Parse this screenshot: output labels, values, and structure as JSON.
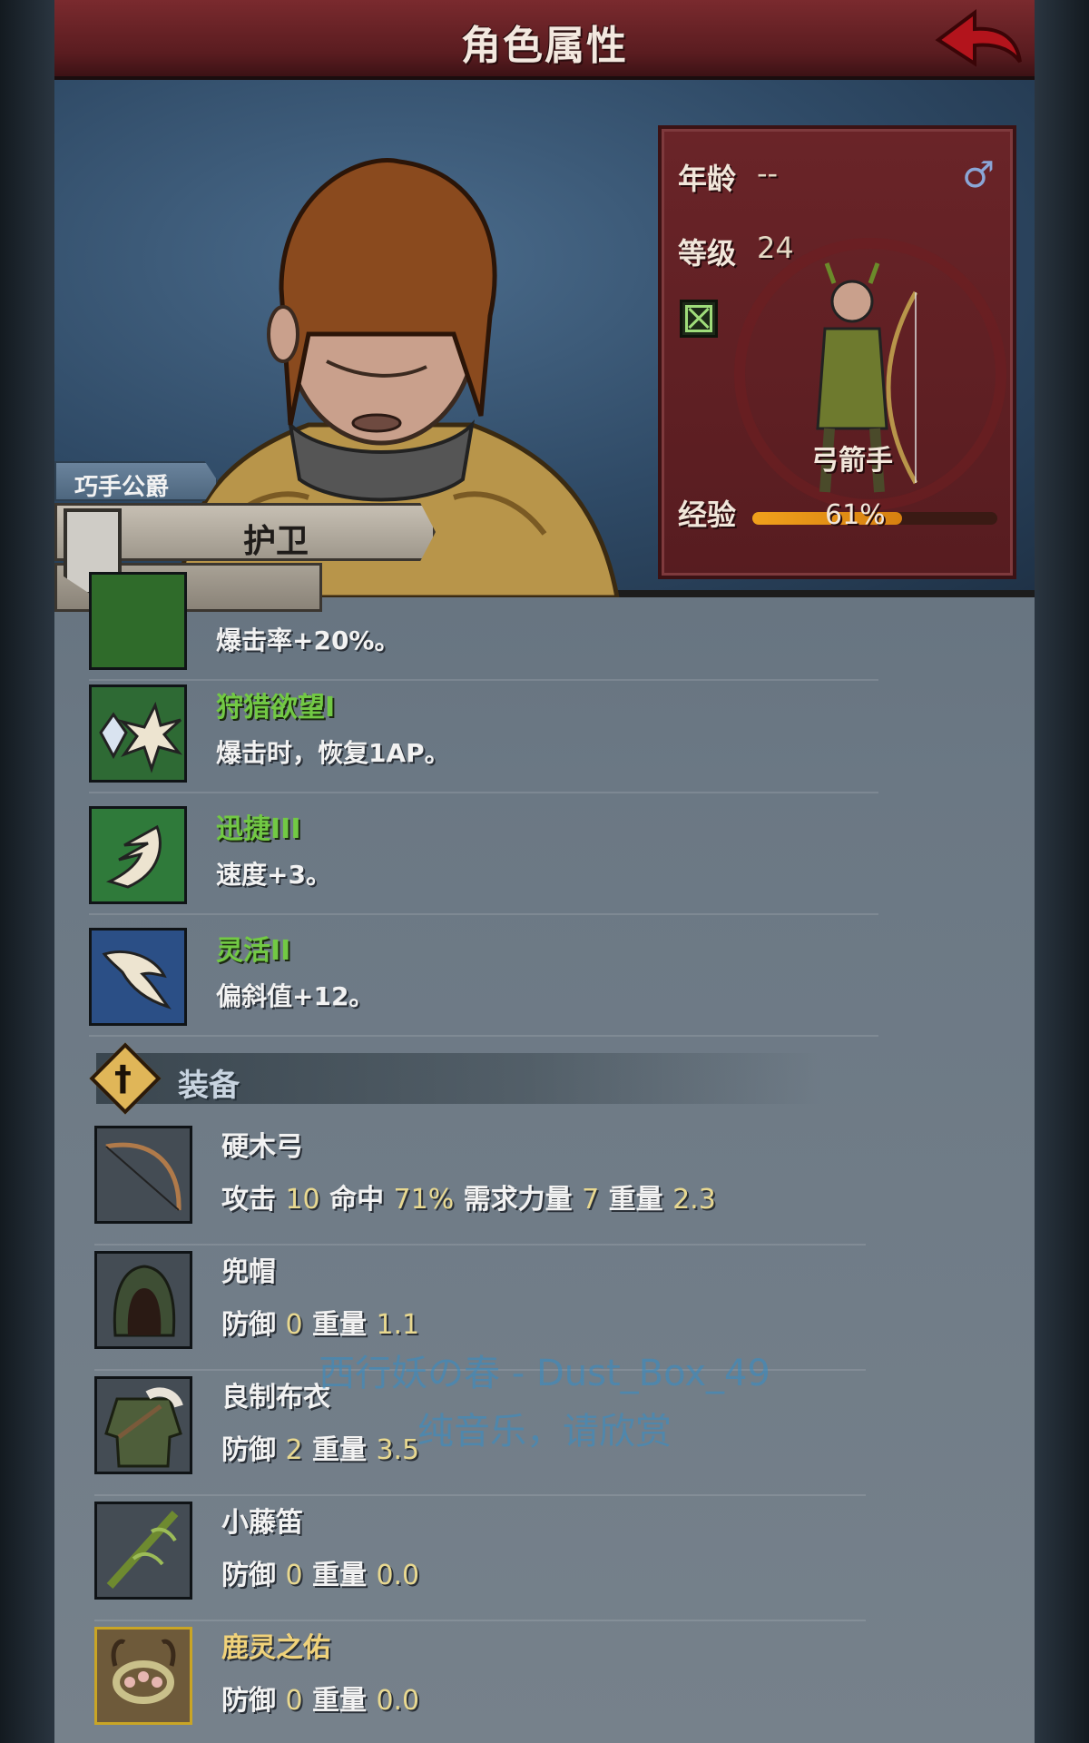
{
  "header": {
    "title": "角色属性"
  },
  "character": {
    "title": "巧手公爵",
    "role": "护卫",
    "age_label": "年龄",
    "age_value": "--",
    "level_label": "等级",
    "level_value": "24",
    "gender_symbol": "♂",
    "class_name": "弓箭手",
    "exp_label": "经验",
    "exp_percent_text": "61%",
    "exp_fraction": 0.61
  },
  "perks": [
    {
      "name": "",
      "desc": "爆击率+20%。",
      "icon": "green-leaf-icon"
    },
    {
      "name": "狩猎欲望I",
      "desc": "爆击时，恢复1AP。",
      "icon": "crystal-burst-icon"
    },
    {
      "name": "迅捷III",
      "desc": "速度+3。",
      "icon": "wing-speed-icon"
    },
    {
      "name": "灵活II",
      "desc": "偏斜值+12。",
      "icon": "feather-icon"
    }
  ],
  "equipment_section": {
    "title": "装备"
  },
  "equipment": [
    {
      "name": "硬木弓",
      "stats": [
        [
          "攻击 ",
          "10"
        ],
        [
          " 命中 ",
          "71%"
        ],
        [
          " 需求力量 ",
          "7"
        ],
        [
          " 重量 ",
          "2.3"
        ]
      ],
      "icon": "bow-icon",
      "gold": false
    },
    {
      "name": "兜帽",
      "stats": [
        [
          "防御 ",
          "0"
        ],
        [
          " 重量 ",
          "1.1"
        ]
      ],
      "icon": "hood-icon",
      "gold": false
    },
    {
      "name": "良制布衣",
      "stats": [
        [
          "防御 ",
          "2"
        ],
        [
          " 重量 ",
          "3.5"
        ]
      ],
      "icon": "cloth-armor-icon",
      "gold": false
    },
    {
      "name": "小藤笛",
      "stats": [
        [
          "防御 ",
          "0"
        ],
        [
          " 重量 ",
          "0.0"
        ]
      ],
      "icon": "vine-flute-icon",
      "gold": false
    },
    {
      "name": "鹿灵之佑",
      "stats": [
        [
          "防御 ",
          "0"
        ],
        [
          " 重量 ",
          "0.0"
        ]
      ],
      "icon": "antler-wreath-icon",
      "gold": true
    }
  ],
  "overlay": {
    "line1": "西行妖の春 - Dust_Box_49",
    "line2": "纯音乐，请欣赏"
  }
}
